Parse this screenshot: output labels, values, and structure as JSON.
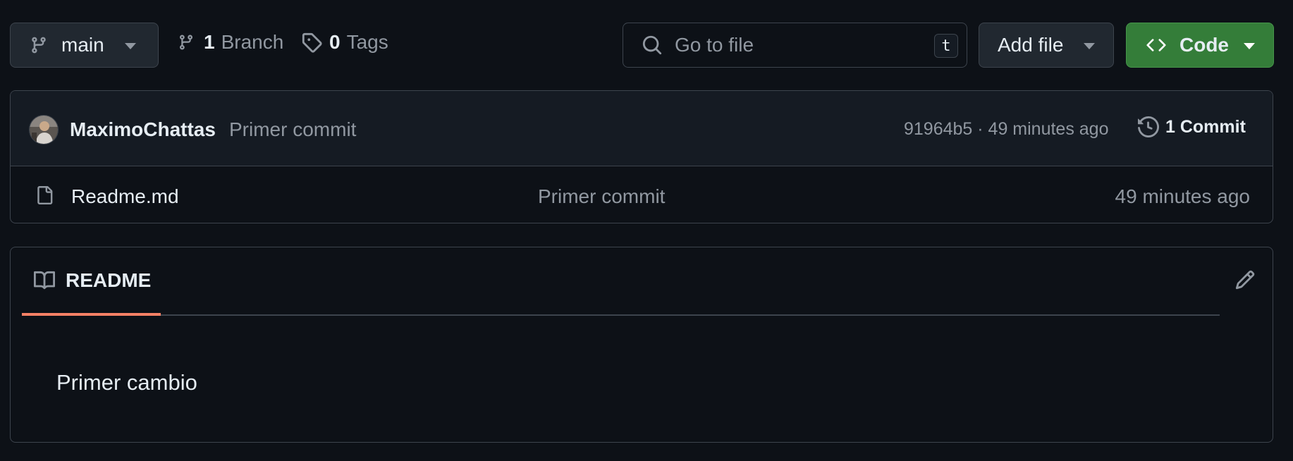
{
  "toolbar": {
    "branch_selector": {
      "label": "main",
      "icon": "git-branch-icon"
    },
    "branches": {
      "count": "1",
      "label": "Branch"
    },
    "tags": {
      "count": "0",
      "label": "Tags"
    },
    "search": {
      "placeholder": "Go to file",
      "shortcut": "t"
    },
    "add_file_label": "Add file",
    "code_label": "Code",
    "colors": {
      "code_button": "#347d39",
      "background": "#0d1117"
    }
  },
  "latest_commit": {
    "author": "MaximoChattas",
    "message": "Primer commit",
    "meta": "91964b5 · 49 minutes ago",
    "commits_count_label": "1 Commit"
  },
  "files": [
    {
      "name": "Readme.md",
      "message": "Primer commit",
      "time": "49 minutes ago",
      "icon": "file-icon"
    }
  ],
  "readme": {
    "tab_label": "README",
    "content": "Primer cambio",
    "colors": {
      "tab_underline": "#f78166"
    }
  }
}
